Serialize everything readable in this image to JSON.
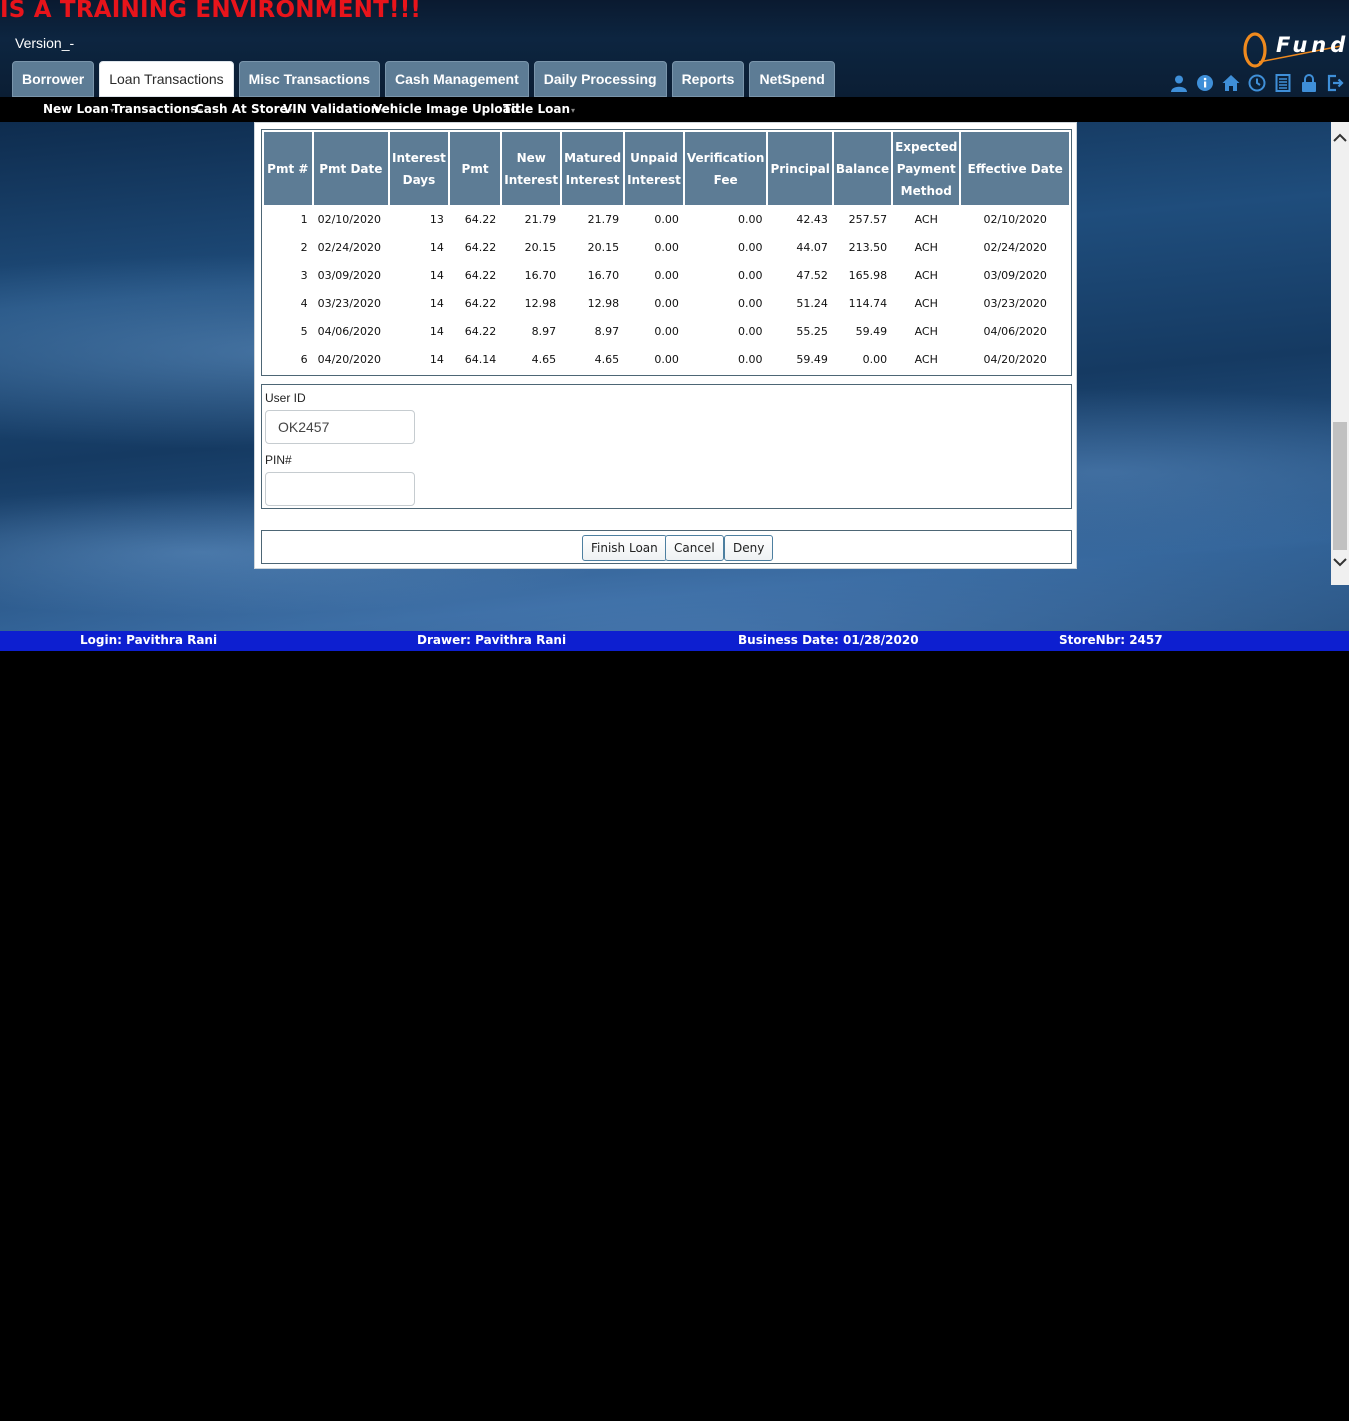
{
  "banner": {
    "training_text": "IS A TRAINING ENVIRONMENT!!!",
    "version": "Version_-"
  },
  "logo": {
    "text": "Fund"
  },
  "tabs": [
    {
      "label": "Borrower",
      "active": false
    },
    {
      "label": "Loan Transactions",
      "active": true
    },
    {
      "label": "Misc Transactions",
      "active": false
    },
    {
      "label": "Cash Management",
      "active": false
    },
    {
      "label": "Daily Processing",
      "active": false
    },
    {
      "label": "Reports",
      "active": false
    },
    {
      "label": "NetSpend",
      "active": false
    }
  ],
  "toolbar_icons": [
    "user-icon",
    "info-icon",
    "home-icon",
    "clock-icon",
    "document-list-icon",
    "lock-icon",
    "logout-icon"
  ],
  "subnav": [
    "New Loan",
    "Transactions",
    "Cash At Store",
    "VIN Validation",
    "Vehicle Image Upload",
    "Title Loan"
  ],
  "schedule": {
    "headers": [
      "Pmt #",
      "Pmt Date",
      "Interest Days",
      "Pmt",
      "New Interest",
      "Matured Interest",
      "Unpaid Interest",
      "Verification Fee",
      "Principal",
      "Balance",
      "Expected Payment Method",
      "Effective Date"
    ],
    "rows": [
      [
        "1",
        "02/10/2020",
        "13",
        "64.22",
        "21.79",
        "21.79",
        "0.00",
        "0.00",
        "42.43",
        "257.57",
        "ACH",
        "02/10/2020"
      ],
      [
        "2",
        "02/24/2020",
        "14",
        "64.22",
        "20.15",
        "20.15",
        "0.00",
        "0.00",
        "44.07",
        "213.50",
        "ACH",
        "02/24/2020"
      ],
      [
        "3",
        "03/09/2020",
        "14",
        "64.22",
        "16.70",
        "16.70",
        "0.00",
        "0.00",
        "47.52",
        "165.98",
        "ACH",
        "03/09/2020"
      ],
      [
        "4",
        "03/23/2020",
        "14",
        "64.22",
        "12.98",
        "12.98",
        "0.00",
        "0.00",
        "51.24",
        "114.74",
        "ACH",
        "03/23/2020"
      ],
      [
        "5",
        "04/06/2020",
        "14",
        "64.22",
        "8.97",
        "8.97",
        "0.00",
        "0.00",
        "55.25",
        "59.49",
        "ACH",
        "04/06/2020"
      ],
      [
        "6",
        "04/20/2020",
        "14",
        "64.14",
        "4.65",
        "4.65",
        "0.00",
        "0.00",
        "59.49",
        "0.00",
        "ACH",
        "04/20/2020"
      ]
    ]
  },
  "auth": {
    "user_id_label": "User ID",
    "user_id_value": "OK2457",
    "pin_label": "PIN#",
    "pin_value": ""
  },
  "buttons": {
    "finish": "Finish Loan",
    "cancel": "Cancel",
    "deny": "Deny"
  },
  "footer": {
    "login": "Login: Pavithra Rani",
    "drawer": "Drawer: Pavithra Rani",
    "business_date": "Business Date: 01/28/2020",
    "store": "StoreNbr: 2457"
  },
  "colors": {
    "tab_bg": "#5d7c95",
    "footer_bg": "#0d1fd0",
    "training_text": "#e8141b",
    "icon_blue": "#3f8fd8",
    "logo_orange": "#f08a1e"
  }
}
